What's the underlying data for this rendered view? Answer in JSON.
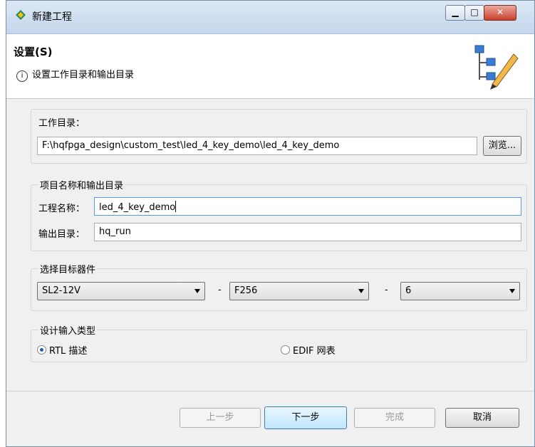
{
  "window": {
    "title": "新建工程"
  },
  "header": {
    "title": "设置(S)",
    "subtitle": "设置工作目录和输出目录"
  },
  "workdir": {
    "label": "工作目录：",
    "value": "F:\\hqfpga_design\\custom_test\\led_4_key_demo\\led_4_key_demo",
    "browse_label": "浏览..."
  },
  "project": {
    "group_label": "项目名称和输出目录",
    "name_label": "工程名称：",
    "name_value": "led_4_key_demo",
    "output_label": "输出目录：",
    "output_value": "hq_run"
  },
  "device": {
    "group_label": "选择目标器件",
    "family": "SL2-12V",
    "package": "F256",
    "speed": "6",
    "separator": "-"
  },
  "input_type": {
    "group_label": "设计输入类型",
    "options": [
      {
        "label": "RTL 描述",
        "selected": true
      },
      {
        "label": "EDIF 网表",
        "selected": false
      }
    ]
  },
  "footer": {
    "prev": "上一步",
    "next": "下一步",
    "finish": "完成",
    "cancel": "取消"
  },
  "colors": {
    "titlebar": "#c5d7ec",
    "close": "#c9402b",
    "primary_button": "#bee6fd"
  }
}
